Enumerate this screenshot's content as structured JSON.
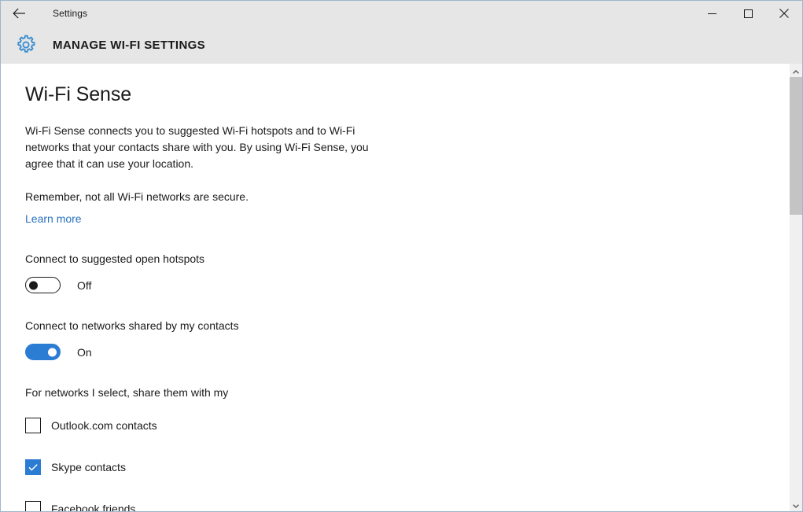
{
  "window": {
    "titlebar": {
      "back_icon": "back-arrow-icon",
      "app_title": "Settings",
      "minimize_label": "—",
      "maximize_label": "□",
      "close_label": "×"
    },
    "header": {
      "icon": "gear-icon",
      "title": "MANAGE WI-FI SETTINGS"
    }
  },
  "content": {
    "section_title": "Wi-Fi Sense",
    "intro_paragraph": "Wi-Fi Sense connects you to suggested Wi-Fi hotspots and to Wi-Fi networks that your contacts share with you. By using Wi-Fi Sense, you agree that it can use your location.",
    "remember_text": "Remember, not all Wi-Fi networks are secure.",
    "learn_more": "Learn more",
    "settings": [
      {
        "label": "Connect to suggested open hotspots",
        "state": "Off",
        "on": false
      },
      {
        "label": "Connect to networks shared by my contacts",
        "state": "On",
        "on": true
      }
    ],
    "share_group_label": "For networks I select, share them with my",
    "checkboxes": [
      {
        "label": "Outlook.com contacts",
        "checked": false
      },
      {
        "label": "Skype contacts",
        "checked": true
      },
      {
        "label": "Facebook friends",
        "checked": false
      }
    ]
  },
  "scrollbar": {
    "up_arrow": "chevron-up-icon",
    "down_arrow": "chevron-down-icon"
  },
  "colors": {
    "accent": "#2b7cd3",
    "link": "#2a72bd",
    "chrome": "#e6e6e6",
    "border": "#9eb6cd",
    "text": "#1a1a1a"
  }
}
